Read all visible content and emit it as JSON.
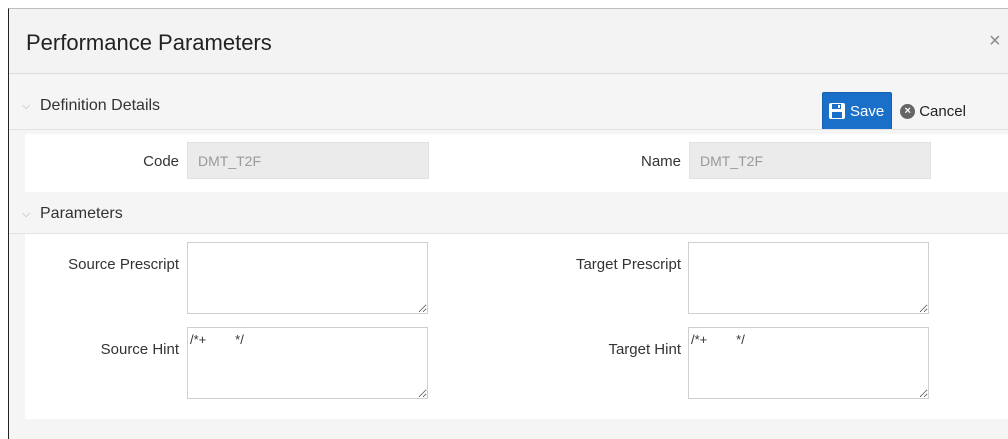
{
  "dialog": {
    "title": "Performance Parameters",
    "close_glyph": "×"
  },
  "toolbar": {
    "save_label": "Save",
    "save_icon": "floppy-disk-icon",
    "cancel_label": "Cancel",
    "cancel_icon": "times-circle-icon",
    "accent": "#1a6fc9"
  },
  "definition": {
    "heading": "Definition Details",
    "code_label": "Code",
    "code_value": "DMT_T2F",
    "name_label": "Name",
    "name_value": "DMT_T2F"
  },
  "parameters": {
    "heading": "Parameters",
    "source_prescript_label": "Source Prescript",
    "source_prescript_value": "",
    "target_prescript_label": "Target Prescript",
    "target_prescript_value": "",
    "source_hint_label": "Source Hint",
    "source_hint_value": "/*+        */",
    "target_hint_label": "Target Hint",
    "target_hint_value": "/*+        */"
  }
}
